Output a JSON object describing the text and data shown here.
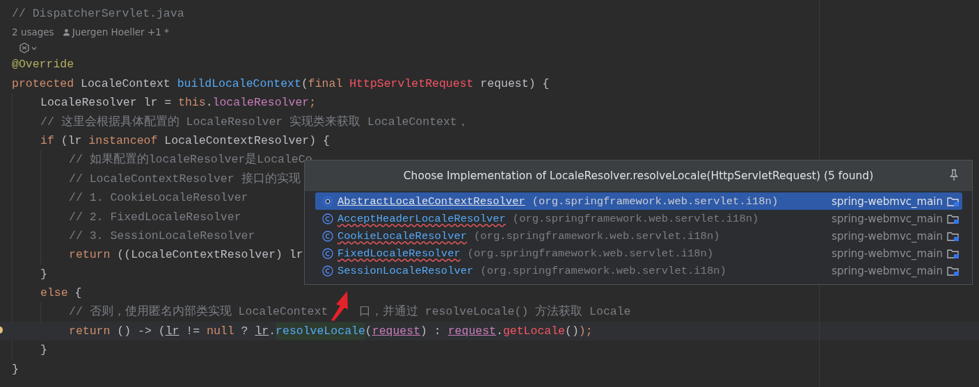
{
  "file_comment": "// DispatcherServlet.java",
  "inlay": {
    "usages": "2 usages",
    "author": "Juergen Hoeller +1 *"
  },
  "code": [
    {
      "tokens": [
        {
          "t": "@Override",
          "kind": "annotation"
        }
      ]
    },
    {
      "tokens": [
        {
          "t": "protected",
          "kind": "keyword"
        },
        {
          "t": " LocaleContext ",
          "kind": "plain"
        },
        {
          "t": "buildLocaleContext",
          "kind": "method-decl"
        },
        {
          "t": "(",
          "kind": "plain"
        },
        {
          "t": "final",
          "kind": "keyword"
        },
        {
          "t": " HttpServletRequest",
          "kind": "error"
        },
        {
          "t": " request) {",
          "kind": "plain"
        }
      ],
      "children": [
        {
          "tokens": [
            {
              "t": "LocaleResolver lr = ",
              "kind": "plain"
            },
            {
              "t": "this",
              "kind": "keyword"
            },
            {
              "t": ".",
              "kind": "plain"
            },
            {
              "t": "localeResolver",
              "kind": "field"
            },
            {
              "t": ";",
              "kind": "keyword"
            }
          ]
        },
        {
          "tokens": [
            {
              "t": "// 这里会根据具体配置的 LocaleResolver 实现类来获取 LocaleContext，",
              "kind": "comment"
            }
          ]
        },
        {
          "tokens": [
            {
              "t": "if",
              "kind": "keyword"
            },
            {
              "t": " (lr ",
              "kind": "plain"
            },
            {
              "t": "instanceof",
              "kind": "keyword"
            },
            {
              "t": " LocaleContextResolver) {",
              "kind": "plain"
            }
          ],
          "children": [
            {
              "tokens": [
                {
                  "t": "// 如果配置的localeResolver是LocaleCo",
                  "kind": "comment"
                }
              ]
            },
            {
              "tokens": [
                {
                  "t": "// LocaleContextResolver 接口的实现",
                  "kind": "comment"
                }
              ]
            },
            {
              "tokens": [
                {
                  "t": "// 1. CookieLocaleResolver",
                  "kind": "comment"
                }
              ]
            },
            {
              "tokens": [
                {
                  "t": "// 2. FixedLocaleResolver",
                  "kind": "comment"
                }
              ]
            },
            {
              "tokens": [
                {
                  "t": "// 3. SessionLocaleResolver",
                  "kind": "comment"
                }
              ]
            },
            {
              "tokens": [
                {
                  "t": "return",
                  "kind": "keyword"
                },
                {
                  "t": " ((LocaleContextResolver) lr",
                  "kind": "plain"
                }
              ]
            }
          ]
        },
        {
          "tokens": [
            {
              "t": "}",
              "kind": "plain"
            }
          ]
        },
        {
          "tokens": [
            {
              "t": "else",
              "kind": "keyword"
            },
            {
              "t": " {",
              "kind": "plain"
            }
          ],
          "children": [
            {
              "tokens": [
                {
                  "t": "// 否则，使用匿名内部类实现 LocaleContext",
                  "kind": "comment"
                },
                {
                  "t": "口，并通过 resolveLocale() 方法获取 Locale",
                  "kind": "comment-after-gap"
                }
              ]
            },
            {
              "current": true,
              "tokens": [
                {
                  "t": "return",
                  "kind": "keyword"
                },
                {
                  "t": " () -> (",
                  "kind": "plain"
                },
                {
                  "t": "lr",
                  "kind": "ref"
                },
                {
                  "t": " != ",
                  "kind": "plain"
                },
                {
                  "t": "null",
                  "kind": "keyword"
                },
                {
                  "t": " ? ",
                  "kind": "plain"
                },
                {
                  "t": "lr",
                  "kind": "ref"
                },
                {
                  "t": ".",
                  "kind": "plain"
                },
                {
                  "t": "resolveLocale",
                  "kind": "highlight"
                },
                {
                  "t": "(",
                  "kind": "plain"
                },
                {
                  "t": "request",
                  "kind": "param"
                },
                {
                  "t": ") : ",
                  "kind": "plain"
                },
                {
                  "t": "request",
                  "kind": "param"
                },
                {
                  "t": ".",
                  "kind": "plain"
                },
                {
                  "t": "getLocale",
                  "kind": "error"
                },
                {
                  "t": "()",
                  "kind": "plain"
                },
                {
                  "t": ");",
                  "kind": "keyword"
                }
              ]
            }
          ]
        },
        {
          "tokens": [
            {
              "t": "}",
              "kind": "plain"
            }
          ]
        }
      ]
    },
    {
      "tokens": [
        {
          "t": "}",
          "kind": "plain"
        }
      ]
    }
  ],
  "popup": {
    "title": "Choose Implementation of LocaleResolver.resolveLocale(HttpServletRequest) (5 found)",
    "items": [
      {
        "kind": "abstract",
        "name": "AbstractLocaleContextResolver",
        "package": "(org.springframework.web.servlet.i18n)",
        "module": "spring-webmvc_main",
        "selected": true,
        "misspelled": false
      },
      {
        "kind": "class",
        "name": "AcceptHeaderLocaleResolver",
        "package": "(org.springframework.web.servlet.i18n)",
        "module": "spring-webmvc_main",
        "selected": false,
        "misspelled": true
      },
      {
        "kind": "class",
        "name": "CookieLocaleResolver",
        "package": "(org.springframework.web.servlet.i18n)",
        "module": "spring-webmvc_main",
        "selected": false,
        "misspelled": true
      },
      {
        "kind": "class",
        "name": "FixedLocaleResolver",
        "package": "(org.springframework.web.servlet.i18n)",
        "module": "spring-webmvc_main",
        "selected": false,
        "misspelled": true
      },
      {
        "kind": "class",
        "name": "SessionLocaleResolver",
        "package": "(org.springframework.web.servlet.i18n)",
        "module": "spring-webmvc_main",
        "selected": false,
        "misspelled": false
      }
    ]
  }
}
